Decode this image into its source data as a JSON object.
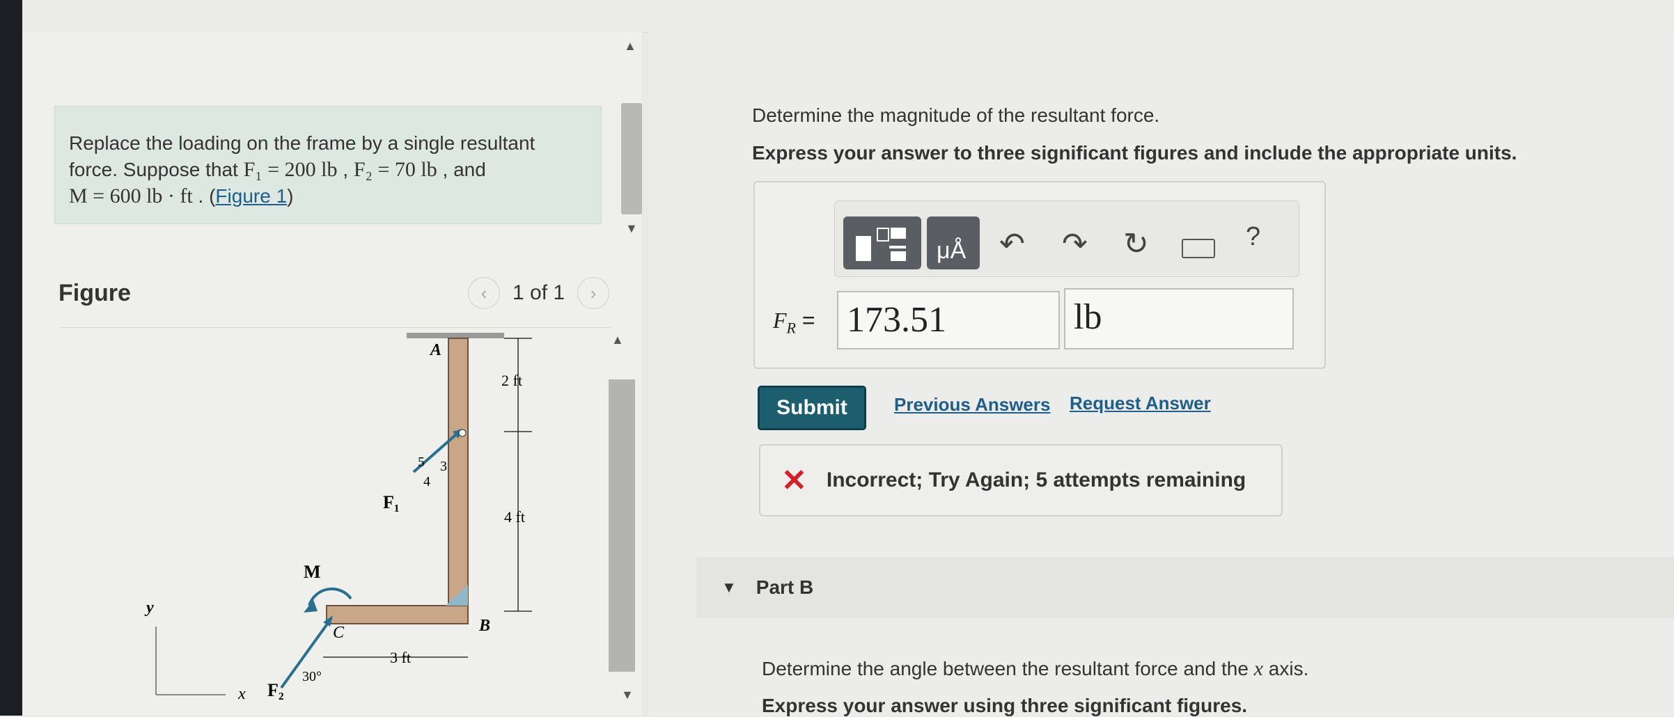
{
  "problem": {
    "intro": "Replace the loading on the frame by a single resultant",
    "line2_prefix": "force. Suppose that ",
    "f1": "F₁ = 200  lb",
    "sep": " , ",
    "f2": "F₂ = 70  lb",
    "and": " , and",
    "m": "M = 600  lb · ft",
    "dot": " . (",
    "figure_link": "Figure 1",
    "close": ")"
  },
  "figure": {
    "label": "Figure",
    "pager_text": "1 of 1",
    "prev_icon": "chevron-left-icon",
    "next_icon": "chevron-right-icon",
    "labels": {
      "A": "A",
      "B": "B",
      "C": "C",
      "M": "M",
      "F1": "F₁",
      "F2": "F₂",
      "y": "y",
      "x": "x",
      "d2ft": "2 ft",
      "d4ft": "4 ft",
      "d3ft": "3 ft",
      "angle": "30°",
      "tri5": "5",
      "tri4": "4",
      "tri3": "3"
    }
  },
  "part_a": {
    "question": "Determine the magnitude of the resultant force.",
    "instruction": "Express your answer to three significant figures and include the appropriate units.",
    "toolbar": {
      "templates_icon": "templates-icon",
      "units_icon": "units-icon",
      "units_label": "μÅ",
      "undo_icon": "undo-icon",
      "redo_icon": "redo-icon",
      "reset_icon": "reset-icon",
      "keyboard_icon": "keyboard-icon",
      "help_label": "?"
    },
    "fr_label": "F",
    "fr_sub": "R",
    "fr_eq": " =",
    "value": "173.51",
    "unit": "lb",
    "submit_label": "Submit",
    "previous_answers": "Previous Answers",
    "request_answer": "Request Answer",
    "feedback": "Incorrect; Try Again; 5 attempts remaining"
  },
  "part_b": {
    "title": "Part B",
    "question_prefix": "Determine the angle between the resultant force and the ",
    "question_var": "x",
    "question_suffix": " axis.",
    "instruction": "Express your answer using three significant figures."
  },
  "colors": {
    "accent": "#1d5e6e",
    "error": "#d21f2a",
    "link": "#1f5e8a"
  }
}
